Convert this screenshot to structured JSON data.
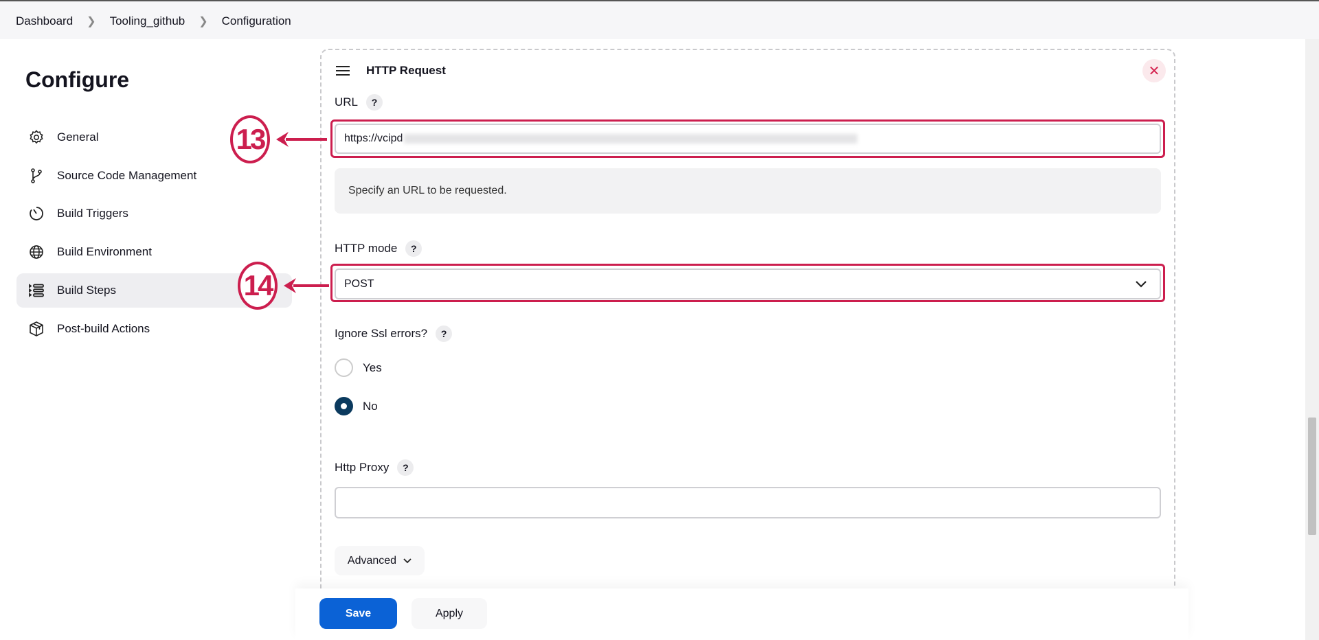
{
  "breadcrumb": [
    "Dashboard",
    "Tooling_github",
    "Configuration"
  ],
  "page_title": "Configure",
  "sidebar": {
    "items": [
      {
        "label": "General",
        "icon": "gear-icon"
      },
      {
        "label": "Source Code Management",
        "icon": "branch-icon"
      },
      {
        "label": "Build Triggers",
        "icon": "timer-icon"
      },
      {
        "label": "Build Environment",
        "icon": "globe-icon"
      },
      {
        "label": "Build Steps",
        "icon": "list-icon",
        "active": true
      },
      {
        "label": "Post-build Actions",
        "icon": "package-icon"
      }
    ]
  },
  "step": {
    "title": "HTTP Request",
    "url": {
      "label": "URL",
      "help": "?",
      "value": "https://vcipd",
      "help_text": "Specify an URL to be requested."
    },
    "mode": {
      "label": "HTTP mode",
      "help": "?",
      "value": "POST"
    },
    "ssl": {
      "label": "Ignore Ssl errors?",
      "help": "?",
      "options": [
        "Yes",
        "No"
      ],
      "selected": "No"
    },
    "proxy": {
      "label": "Http Proxy",
      "help": "?",
      "value": ""
    },
    "advanced": "Advanced"
  },
  "footer": {
    "save": "Save",
    "apply": "Apply"
  },
  "annotations": [
    "13",
    "14"
  ],
  "colors": {
    "accent": "#0b62d6",
    "annotation": "#cc1e4e",
    "radio": "#0b3a5e"
  }
}
